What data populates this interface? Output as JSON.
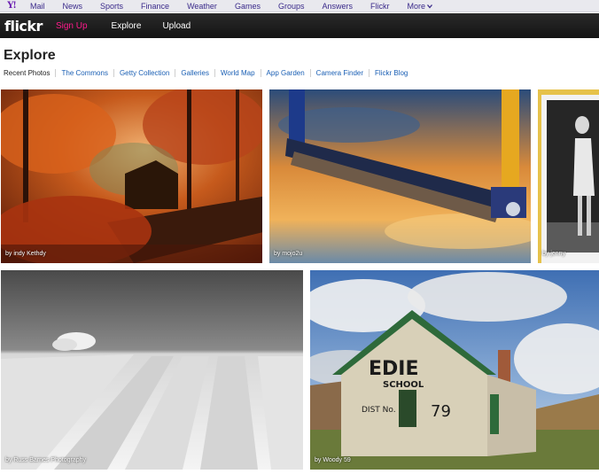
{
  "yahoo_bar": {
    "items": [
      "Mail",
      "News",
      "Sports",
      "Finance",
      "Weather",
      "Games",
      "Groups",
      "Answers",
      "Flickr",
      "More"
    ]
  },
  "flickr_bar": {
    "logo": "flickr",
    "signup": "Sign Up",
    "explore": "Explore",
    "upload": "Upload"
  },
  "page": {
    "title": "Explore",
    "current_tab": "Recent Photos",
    "tabs": [
      "The Commons",
      "Getty Collection",
      "Galleries",
      "World Map",
      "App Garden",
      "Camera Finder",
      "Flickr Blog"
    ]
  },
  "photos": [
    {
      "credit": "by indy Kethdy"
    },
    {
      "credit": "by mojo2u"
    },
    {
      "credit": "by jenny"
    },
    {
      "credit": "by Russ Barnes Photography"
    },
    {
      "credit": "by Woody 59"
    }
  ],
  "photo5_sign": {
    "line1": "EDIE",
    "line2": "SCHOOL",
    "line3": "DIST No.",
    "line4": "79"
  },
  "colors": {
    "brand_pink": "#ff1a8c",
    "link_blue": "#1a5fb4",
    "yahoo_purple": "#3a2a8a"
  }
}
